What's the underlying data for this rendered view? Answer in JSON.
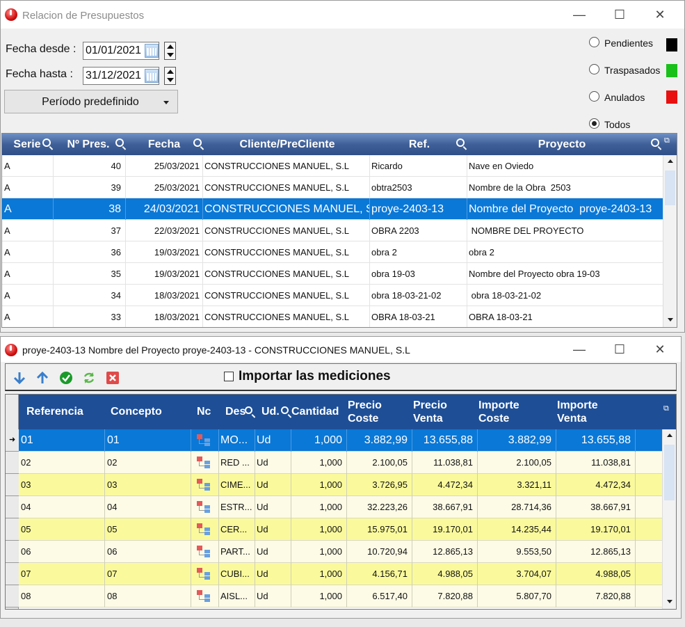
{
  "win1": {
    "title": "Relacion de Presupuestos",
    "fecha_desde_label": "Fecha desde :",
    "fecha_desde": "01/01/2021",
    "fecha_hasta_label": "Fecha hasta :",
    "fecha_hasta": "31/12/2021",
    "periodo_button": "Período predefinido",
    "filters": [
      {
        "label": "Pendientes",
        "color": "#000000",
        "selected": false
      },
      {
        "label": "Traspasados",
        "color": "#19c019",
        "selected": false
      },
      {
        "label": "Anulados",
        "color": "#e81010",
        "selected": false
      },
      {
        "label": "Todos",
        "color": "",
        "selected": true
      }
    ],
    "columns": [
      "Serie",
      "Nº Pres.",
      "Fecha",
      "Cliente/PreCliente",
      "Ref.",
      "Proyecto"
    ],
    "rows": [
      {
        "serie": "A",
        "num": "40",
        "fecha": "25/03/2021",
        "cliente": "CONSTRUCCIONES MANUEL, S.L",
        "ref": "Ricardo",
        "proyecto": "Nave en Oviedo"
      },
      {
        "serie": "A",
        "num": "39",
        "fecha": "25/03/2021",
        "cliente": "CONSTRUCCIONES MANUEL, S.L",
        "ref": "obtra2503",
        "proyecto": "Nombre de la Obra  2503"
      },
      {
        "serie": "A",
        "num": "38",
        "fecha": "24/03/2021",
        "cliente": "CONSTRUCCIONES MANUEL, S",
        "ref": "proye-2403-13",
        "proyecto": "Nombre del Proyecto  proye-2403-13"
      },
      {
        "serie": "A",
        "num": "37",
        "fecha": "22/03/2021",
        "cliente": "CONSTRUCCIONES MANUEL, S.L",
        "ref": "OBRA 2203",
        "proyecto": " NOMBRE DEL PROYECTO"
      },
      {
        "serie": "A",
        "num": "36",
        "fecha": "19/03/2021",
        "cliente": "CONSTRUCCIONES MANUEL, S.L",
        "ref": "obra 2",
        "proyecto": "obra 2"
      },
      {
        "serie": "A",
        "num": "35",
        "fecha": "19/03/2021",
        "cliente": "CONSTRUCCIONES MANUEL, S.L",
        "ref": "obra 19-03",
        "proyecto": "Nombre del Proyecto obra 19-03"
      },
      {
        "serie": "A",
        "num": "34",
        "fecha": "18/03/2021",
        "cliente": "CONSTRUCCIONES MANUEL, S.L",
        "ref": "obra 18-03-21-02",
        "proyecto": " obra 18-03-21-02"
      },
      {
        "serie": "A",
        "num": "33",
        "fecha": "18/03/2021",
        "cliente": "CONSTRUCCIONES MANUEL, S.L",
        "ref": "OBRA 18-03-21",
        "proyecto": "OBRA 18-03-21"
      }
    ],
    "selected_row": 2
  },
  "win2": {
    "title": "proye-2403-13  Nombre del Proyecto  proye-2403-13 - CONSTRUCCIONES MANUEL, S.L",
    "import_label": "Importar las mediciones",
    "columns": {
      "ref": "Referencia",
      "concepto": "Concepto",
      "nc": "Nc",
      "des": "Des",
      "ud": "Ud.",
      "cantidad": "Cantidad",
      "precio_coste_1": "Precio",
      "precio_coste_2": "Coste",
      "precio_venta_1": "Precio",
      "precio_venta_2": "Venta",
      "importe_coste_1": "Importe",
      "importe_coste_2": "Coste",
      "importe_venta_1": "Importe",
      "importe_venta_2": "Venta"
    },
    "rows": [
      {
        "ref": "01",
        "concepto": "01",
        "des": "MO...",
        "ud": "Ud",
        "cantidad": "1,000",
        "pc": "3.882,99",
        "pv": "13.655,88",
        "ic": "3.882,99",
        "iv": "13.655,88"
      },
      {
        "ref": "02",
        "concepto": "02",
        "des": "RED ...",
        "ud": "Ud",
        "cantidad": "1,000",
        "pc": "2.100,05",
        "pv": "11.038,81",
        "ic": "2.100,05",
        "iv": "11.038,81"
      },
      {
        "ref": "03",
        "concepto": "03",
        "des": "CIME...",
        "ud": "Ud",
        "cantidad": "1,000",
        "pc": "3.726,95",
        "pv": "4.472,34",
        "ic": "3.321,11",
        "iv": "4.472,34"
      },
      {
        "ref": "04",
        "concepto": "04",
        "des": "ESTR...",
        "ud": "Ud",
        "cantidad": "1,000",
        "pc": "32.223,26",
        "pv": "38.667,91",
        "ic": "28.714,36",
        "iv": "38.667,91"
      },
      {
        "ref": "05",
        "concepto": "05",
        "des": "CER...",
        "ud": "Ud",
        "cantidad": "1,000",
        "pc": "15.975,01",
        "pv": "19.170,01",
        "ic": "14.235,44",
        "iv": "19.170,01"
      },
      {
        "ref": "06",
        "concepto": "06",
        "des": "PART...",
        "ud": "Ud",
        "cantidad": "1,000",
        "pc": "10.720,94",
        "pv": "12.865,13",
        "ic": "9.553,50",
        "iv": "12.865,13"
      },
      {
        "ref": "07",
        "concepto": "07",
        "des": "CUBI...",
        "ud": "Ud",
        "cantidad": "1,000",
        "pc": "4.156,71",
        "pv": "4.988,05",
        "ic": "3.704,07",
        "iv": "4.988,05"
      },
      {
        "ref": "08",
        "concepto": "08",
        "des": "AISL...",
        "ud": "Ud",
        "cantidad": "1,000",
        "pc": "6.517,40",
        "pv": "7.820,88",
        "ic": "5.807,70",
        "iv": "7.820,88"
      }
    ],
    "selected_row": 0
  }
}
